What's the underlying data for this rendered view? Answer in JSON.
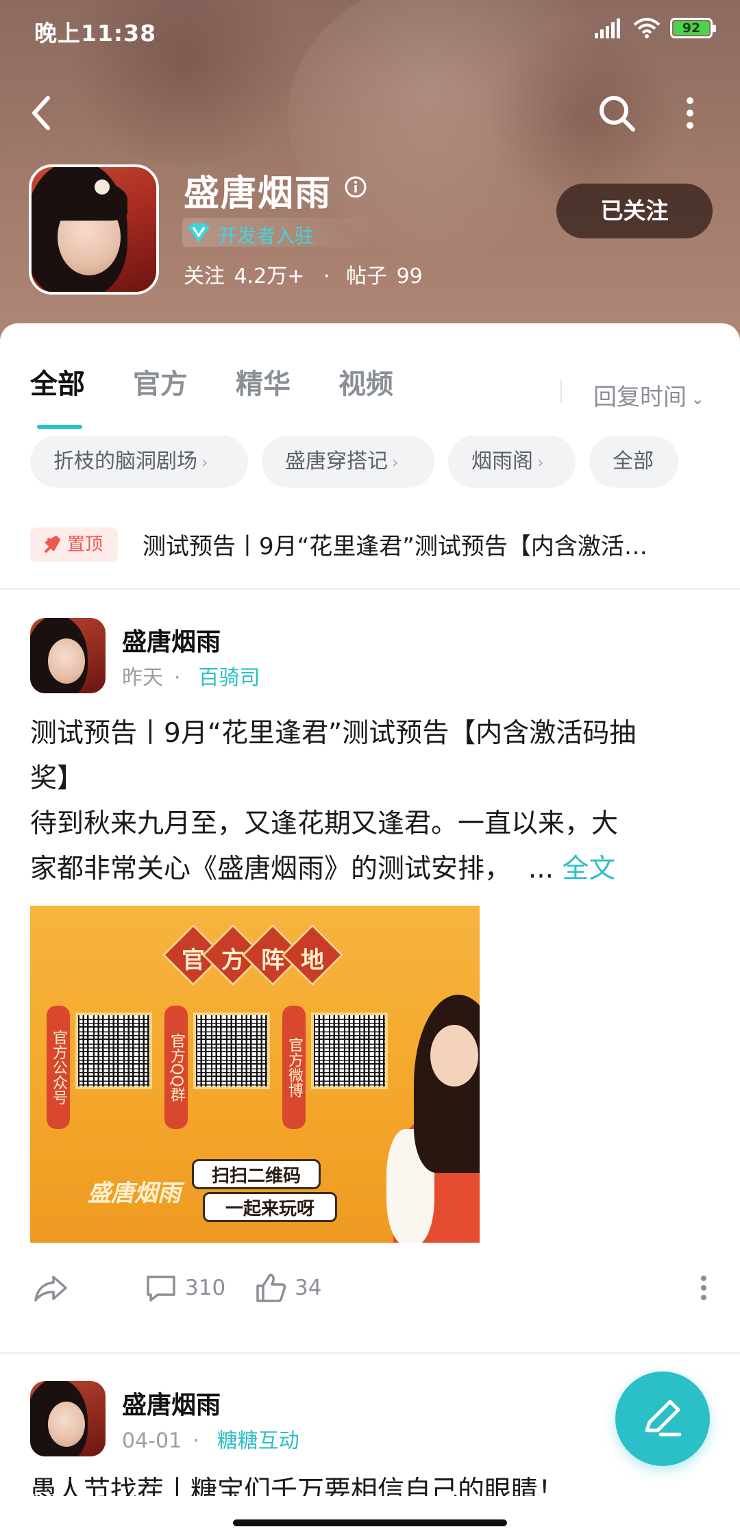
{
  "status_bar": {
    "time": "晚上11:38",
    "battery": "92"
  },
  "header": {
    "game_name": "盛唐烟雨",
    "badge": "开发者入驻",
    "stats": {
      "follow_label": "关注",
      "follow_count": "4.2万+",
      "posts_label": "帖子",
      "posts_count": "99",
      "separator": "·"
    },
    "follow_button": "已关注"
  },
  "tabs": [
    {
      "label": "全部",
      "active": true
    },
    {
      "label": "官方",
      "active": false
    },
    {
      "label": "精华",
      "active": false
    },
    {
      "label": "视频",
      "active": false
    }
  ],
  "sort": {
    "label": "回复时间"
  },
  "chips": [
    {
      "label": "折枝的脑洞剧场",
      "arrow": "›"
    },
    {
      "label": "盛唐穿搭记",
      "arrow": "›"
    },
    {
      "label": "烟雨阁",
      "arrow": "›"
    },
    {
      "label": "全部",
      "arrow": ""
    }
  ],
  "pinned": {
    "badge": "置顶",
    "text": "测试预告丨9月“花里逢君”测试预告【内含激活…"
  },
  "posts": [
    {
      "author": "盛唐烟雨",
      "time": "昨天",
      "tag": "百骑司",
      "title_line1": "测试预告丨9月“花里逢君”测试预告【内含激活码抽",
      "title_line2": "奖】",
      "body_line1": "待到秋来九月至，又逢花期又逢君。一直以来，大",
      "body_line2": "家都非常关心《盛唐烟雨》的测试安排，",
      "ellipsis": "...",
      "more": "全文",
      "image": {
        "title_chars": [
          "官",
          "方",
          "阵",
          "地"
        ],
        "qr_labels": [
          "官方公众号",
          "官方QQ群",
          "官方微博"
        ],
        "bubble_line1": "扫扫二维码",
        "bubble_line2": "一起来玩呀",
        "logo": "盛唐烟雨"
      },
      "comments": "310",
      "likes": "34"
    },
    {
      "author": "盛唐烟雨",
      "time": "04-01",
      "tag": "糖糖互动",
      "title_line1": "愚人节找茬丨糖宝们千万要相信自己的眼睛！"
    }
  ],
  "colors": {
    "accent": "#2bbfc7",
    "pin": "#f0584d",
    "header": "#9a7566"
  }
}
